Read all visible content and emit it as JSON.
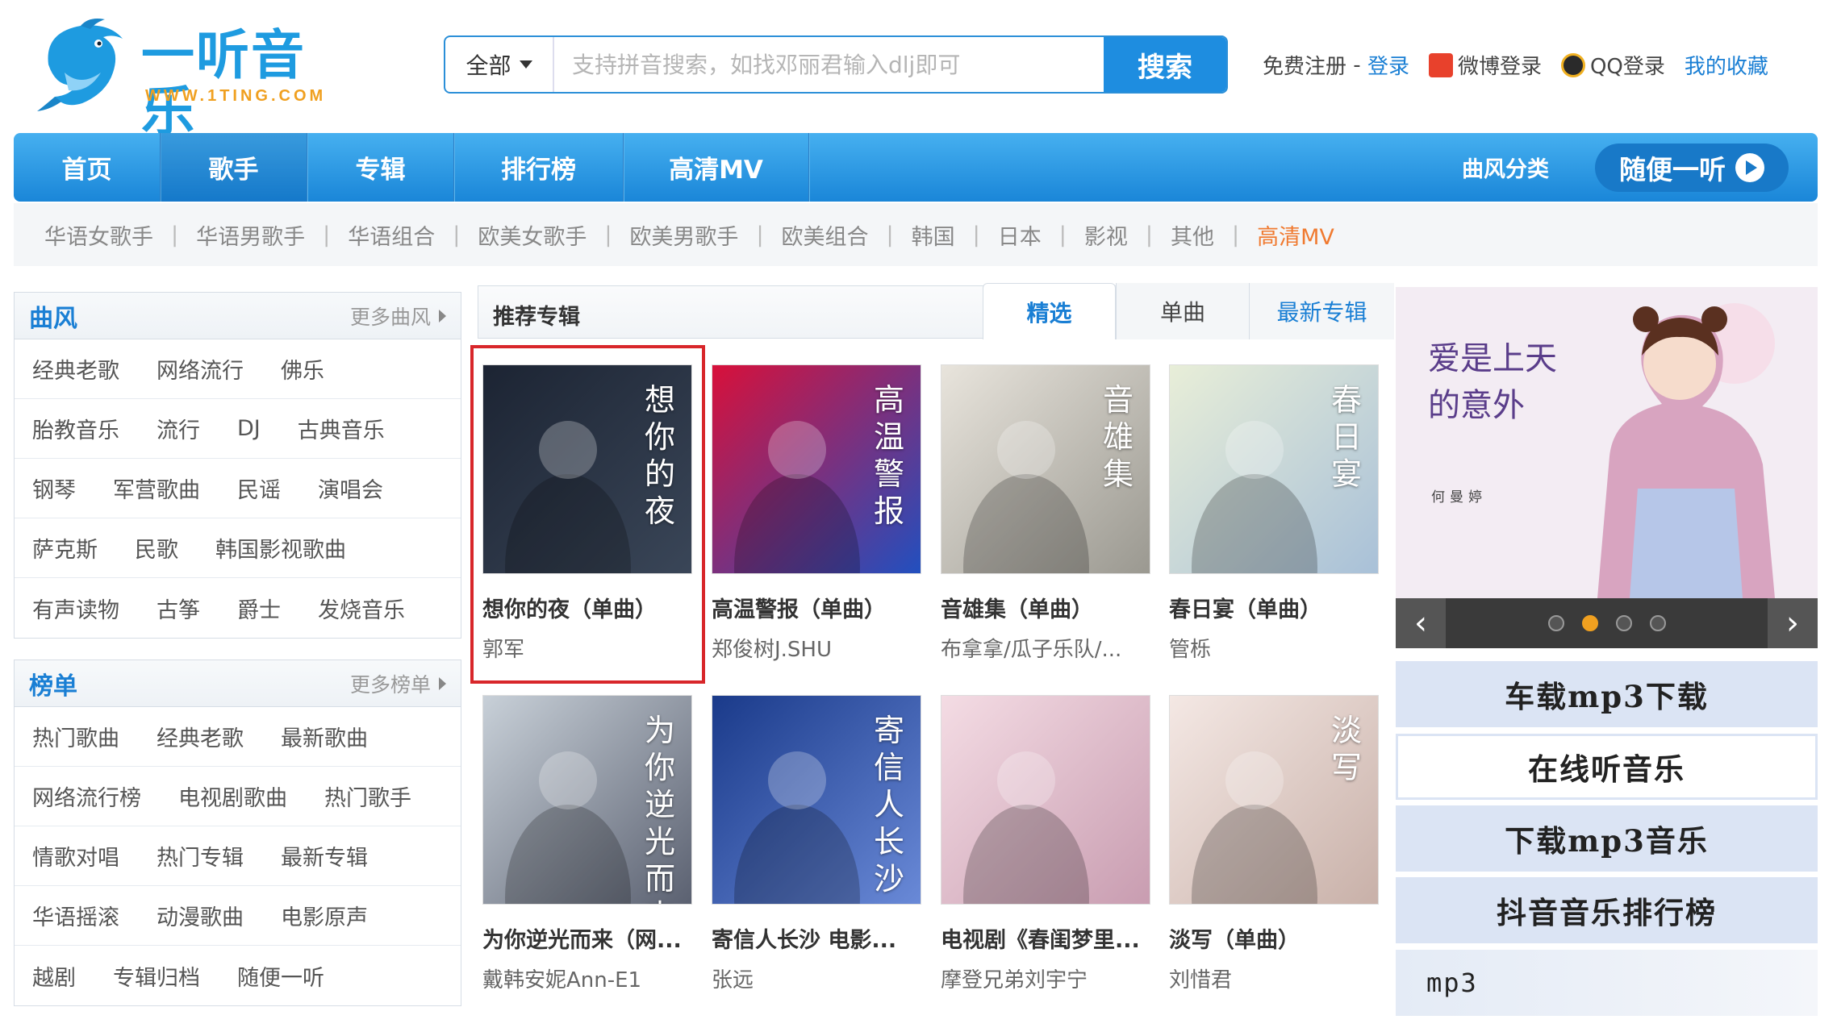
{
  "logo": {
    "title": "一听音乐",
    "url_text": "WWW.1TING.COM"
  },
  "search": {
    "category": "全部",
    "placeholder": "支持拼音搜索，如找邓丽君输入dlj即可",
    "button": "搜索"
  },
  "toplinks": {
    "register": "免费注册",
    "dash": " - ",
    "login": "登录",
    "weibo": "微博登录",
    "qq": "QQ登录",
    "favorites": "我的收藏"
  },
  "nav": {
    "items": [
      "首页",
      "歌手",
      "专辑",
      "排行榜",
      "高清MV"
    ],
    "active_index": 1,
    "genre": "曲风分类",
    "random": "随便一听"
  },
  "subnav": [
    "华语女歌手",
    "华语男歌手",
    "华语组合",
    "欧美女歌手",
    "欧美男歌手",
    "欧美组合",
    "韩国",
    "日本",
    "影视",
    "其他",
    "高清MV"
  ],
  "genre_panel": {
    "title": "曲风",
    "more": "更多曲风",
    "rows": [
      [
        "经典老歌",
        "网络流行",
        "佛乐"
      ],
      [
        "胎教音乐",
        "流行",
        "DJ",
        "古典音乐"
      ],
      [
        "钢琴",
        "军营歌曲",
        "民谣",
        "演唱会"
      ],
      [
        "萨克斯",
        "民歌",
        "韩国影视歌曲"
      ],
      [
        "有声读物",
        "古筝",
        "爵士",
        "发烧音乐"
      ]
    ]
  },
  "chart_panel": {
    "title": "榜单",
    "more": "更多榜单",
    "rows": [
      [
        "热门歌曲",
        "经典老歌",
        "最新歌曲"
      ],
      [
        "网络流行榜",
        "电视剧歌曲",
        "热门歌手"
      ],
      [
        "情歌对唱",
        "热门专辑",
        "最新专辑"
      ],
      [
        "华语摇滚",
        "动漫歌曲",
        "电影原声"
      ],
      [
        "越剧",
        "专辑归档",
        "随便一听"
      ]
    ]
  },
  "recommend": {
    "title": "推荐专辑",
    "tabs": [
      "精选",
      "单曲",
      "最新专辑"
    ],
    "active_tab": 0,
    "albums": [
      {
        "name": "想你的夜（单曲）",
        "artist": "郭军",
        "cover_text": "想你的夜",
        "colors": [
          "#1c2433",
          "#3a4658"
        ]
      },
      {
        "name": "高温警报（单曲）",
        "artist": "郑俊树J.SHU",
        "cover_text": "高温警报",
        "colors": [
          "#d8103a",
          "#2050c0"
        ]
      },
      {
        "name": "音雄集（单曲）",
        "artist": "布拿拿/瓜子乐队/...",
        "cover_text": "音雄集",
        "colors": [
          "#e8e4dc",
          "#9a9890"
        ]
      },
      {
        "name": "春日宴（单曲）",
        "artist": "管栎",
        "cover_text": "春日宴",
        "colors": [
          "#e8eed8",
          "#a8c0d8"
        ]
      },
      {
        "name": "为你逆光而来（网...",
        "artist": "戴韩安妮Ann-E1",
        "cover_text": "为你逆光而来",
        "colors": [
          "#c8d0d8",
          "#5a6070"
        ]
      },
      {
        "name": "寄信人长沙 电影...",
        "artist": "张远",
        "cover_text": "寄信人长沙",
        "colors": [
          "#1a3a8a",
          "#6a8ad8"
        ]
      },
      {
        "name": "电视剧《春闺梦里...",
        "artist": "摩登兄弟刘宇宁",
        "cover_text": "",
        "colors": [
          "#f4dce4",
          "#c89cb0"
        ]
      },
      {
        "name": "淡写（单曲）",
        "artist": "刘惜君",
        "cover_text": "淡写",
        "colors": [
          "#f4e8e4",
          "#c8b0a8"
        ]
      }
    ]
  },
  "banner": {
    "text": "爱是上天的意外",
    "artist": "何曼婷",
    "slides": 4,
    "current": 1
  },
  "side_buttons": [
    "车载mp3下载",
    "在线听音乐",
    "下载mp3音乐",
    "抖音音乐排行榜",
    "mp3"
  ],
  "colors": {
    "brand": "#1e8de0",
    "nav": "#1a86d8",
    "highlight": "#d8262a",
    "accent": "#f07a30"
  }
}
